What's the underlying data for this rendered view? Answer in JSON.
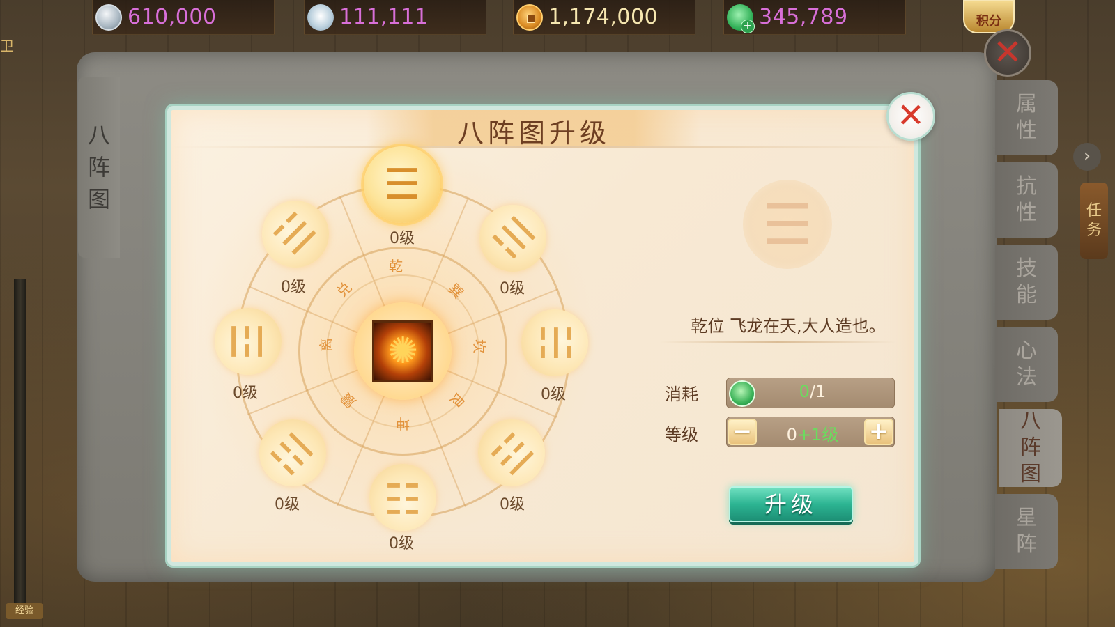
{
  "currencies": [
    {
      "name": "yuan-coin",
      "icon": "yuan-coin-icon",
      "value": "610,000",
      "color": "#d86fd8"
    },
    {
      "name": "silver-ingot",
      "icon": "silver-ingot-icon",
      "value": "111,111",
      "color": "#d86fd8"
    },
    {
      "name": "copper-coin",
      "icon": "copper-coin-icon",
      "value": "1,174,000",
      "color": "#f6e7b0"
    },
    {
      "name": "jade",
      "icon": "jade-plus-icon",
      "value": "345,789",
      "color": "#d86fd8"
    }
  ],
  "score_badge": "积分",
  "scene": {
    "left_mark": "卫",
    "bottom_chip": "经验"
  },
  "left_tab": {
    "chars": [
      "八",
      "阵",
      "图"
    ]
  },
  "side_tabs": [
    {
      "chars": [
        "属",
        "性"
      ],
      "active": false
    },
    {
      "chars": [
        "抗",
        "性"
      ],
      "active": false
    },
    {
      "chars": [
        "技",
        "能"
      ],
      "active": false
    },
    {
      "chars": [
        "心",
        "法"
      ],
      "active": false
    },
    {
      "chars": [
        "八",
        "阵",
        "图"
      ],
      "active": true
    },
    {
      "chars": [
        "星",
        "阵"
      ],
      "active": false
    }
  ],
  "task_tag": {
    "chars": [
      "任",
      "务"
    ]
  },
  "dialog": {
    "title": "八阵图升级",
    "close_icon": "close-x-icon"
  },
  "wheel": {
    "trigrams": [
      {
        "name": "qian",
        "glyph": "☰",
        "level": "0级",
        "active": true
      },
      {
        "name": "xun",
        "glyph": "☴",
        "level": "0级",
        "active": false
      },
      {
        "name": "kan",
        "glyph": "☵",
        "level": "0级",
        "active": false
      },
      {
        "name": "gen",
        "glyph": "☶",
        "level": "0级",
        "active": false
      },
      {
        "name": "kun",
        "glyph": "☷",
        "level": "0级",
        "active": false
      },
      {
        "name": "zhen",
        "glyph": "☳",
        "level": "0级",
        "active": false
      },
      {
        "name": "li",
        "glyph": "☲",
        "level": "0级",
        "active": false
      },
      {
        "name": "dui",
        "glyph": "☱",
        "level": "0级",
        "active": false
      }
    ],
    "inner_chars": [
      "乾",
      "巽",
      "坎",
      "艮",
      "坤",
      "震",
      "离",
      "兑"
    ],
    "center_icon": "shuriken-emblem-icon"
  },
  "detail": {
    "emblem_glyph": "☰",
    "motto": "乾位 飞龙在天,大人造也。",
    "cost_label": "消耗",
    "cost_have": "0",
    "cost_need": "/1",
    "level_label": "等级",
    "level_base": "0",
    "level_add": "+1级",
    "minus": "−",
    "plus": "+",
    "upgrade_label": "升级"
  }
}
